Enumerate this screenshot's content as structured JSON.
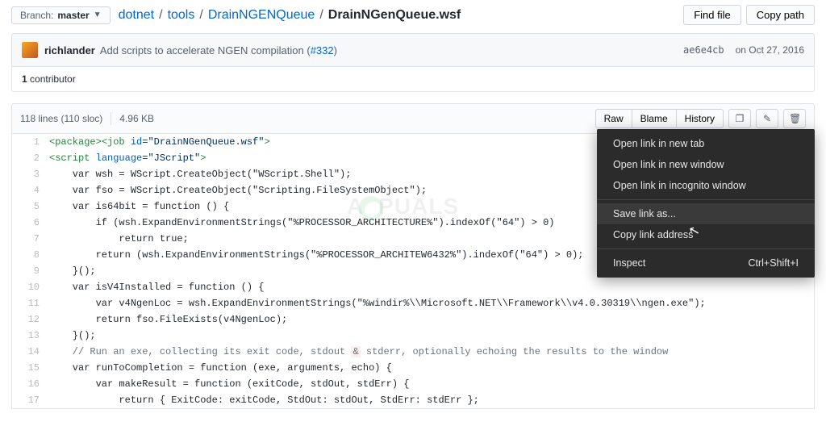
{
  "branch": {
    "label": "Branch:",
    "name": "master"
  },
  "breadcrumb": {
    "root": "dotnet",
    "a": "tools",
    "b": "DrainNGENQueue",
    "file": "DrainNGenQueue.wsf"
  },
  "headerButtons": {
    "find": "Find file",
    "copy": "Copy path"
  },
  "commit": {
    "author": "richlander",
    "message": "Add scripts to accelerate NGEN compilation (",
    "pr": "#332",
    "messageEnd": ")",
    "sha": "ae6e4cb",
    "date": "on Oct 27, 2016"
  },
  "contributors": {
    "count": "1",
    "label": " contributor"
  },
  "fileinfo": {
    "lines": "118 lines (110 sloc)",
    "size": "4.96 KB"
  },
  "fileActions": {
    "raw": "Raw",
    "blame": "Blame",
    "history": "History"
  },
  "contextMenu": {
    "open_tab": "Open link in new tab",
    "open_win": "Open link in new window",
    "open_incog": "Open link in incognito window",
    "save_as": "Save link as...",
    "copy_addr": "Copy link address",
    "inspect": "Inspect",
    "shortcut": "Ctrl+Shift+I"
  },
  "code": {
    "l1a": "<package>",
    "l1b": "<job",
    "l1c": " id",
    "l1d": "=",
    "l1e": "\"DrainNGenQueue.wsf\"",
    "l1f": ">",
    "l2a": "<script",
    "l2b": " language",
    "l2c": "=",
    "l2d": "\"JScript\"",
    "l2e": ">",
    "l3": "    var wsh = WScript.CreateObject(\"WScript.Shell\");",
    "l4": "    var fso = WScript.CreateObject(\"Scripting.FileSystemObject\");",
    "l5": "    var is64bit = function () {",
    "l6": "        if (wsh.ExpandEnvironmentStrings(\"%PROCESSOR_ARCHITECTURE%\").indexOf(\"64\") > 0)",
    "l7": "            return true;",
    "l8": "        return (wsh.ExpandEnvironmentStrings(\"%PROCESSOR_ARCHITEW6432%\").indexOf(\"64\") > 0);",
    "l9": "    }();",
    "l10": "    var isV4Installed = function () {",
    "l11": "        var v4NgenLoc = wsh.ExpandEnvironmentStrings(\"%windir%\\\\Microsoft.NET\\\\Framework\\\\v4.0.30319\\\\ngen.exe\");",
    "l12": "        return fso.FileExists(v4NgenLoc);",
    "l13": "    }();",
    "l14a": "    // Run an exe, collecting its exit code, stdout ",
    "l14b": "&",
    "l14c": " stderr, optionally echoing the results to the window",
    "l15": "    var runToCompletion = function (exe, arguments, echo) {",
    "l16": "        var makeResult = function (exitCode, stdOut, stdErr) {",
    "l17": "            return { ExitCode: exitCode, StdOut: stdOut, StdErr: stdErr };"
  },
  "watermark": "A   PUALS"
}
